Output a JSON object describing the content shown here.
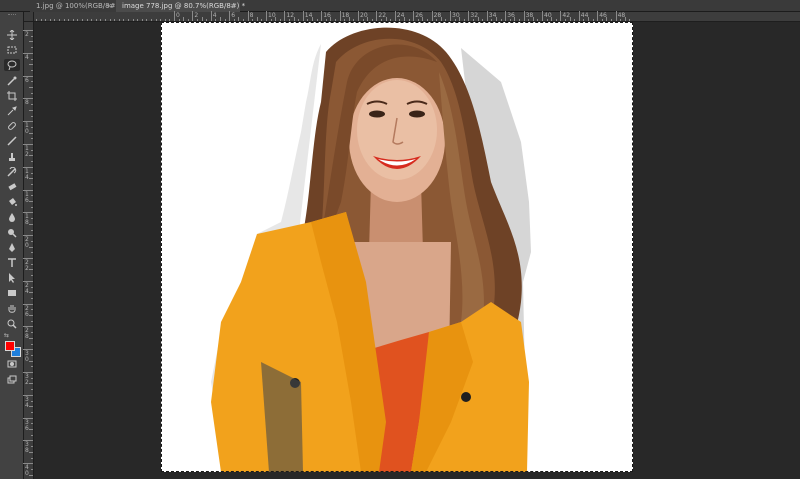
{
  "tabs": [
    {
      "label": "1.jpg @ 100%(RGB/8#)",
      "close": "×",
      "active": false
    },
    {
      "label": "image 778.jpg @ 80.7%(RGB/8#) *",
      "close": "×",
      "active": true
    }
  ],
  "ruler_top_labels": [
    "0",
    "2",
    "4",
    "6",
    "8",
    "10",
    "12",
    "14",
    "16",
    "18",
    "20",
    "22",
    "24",
    "26",
    "28",
    "30",
    "32",
    "34",
    "36",
    "38",
    "40",
    "42",
    "44",
    "46",
    "48"
  ],
  "ruler_left_labels": [
    "2",
    "4",
    "6",
    "8",
    "1 0",
    "1 2",
    "1 4",
    "1 6",
    "1 8",
    "2 0",
    "2 2",
    "2 4",
    "2 6",
    "2 8",
    "3 0",
    "3 2",
    "3 4",
    "3 6",
    "3 8",
    "4 0"
  ],
  "tools": [
    "move-icon",
    "marquee-icon",
    "lasso-icon",
    "quick-select-icon",
    "crop-icon",
    "eyedropper-icon",
    "healing-brush-icon",
    "brush-icon",
    "clone-stamp-icon",
    "history-brush-icon",
    "eraser-icon",
    "paint-bucket-icon",
    "blur-icon",
    "dodge-icon",
    "pen-icon",
    "type-icon",
    "path-select-icon",
    "rectangle-icon",
    "hand-icon",
    "zoom-icon"
  ],
  "colors": {
    "foreground": "#ff0000",
    "background": "#1e7fdc",
    "jacket": "#f2a21c",
    "hair": "#7a4a2a",
    "top": "#e0521f"
  }
}
